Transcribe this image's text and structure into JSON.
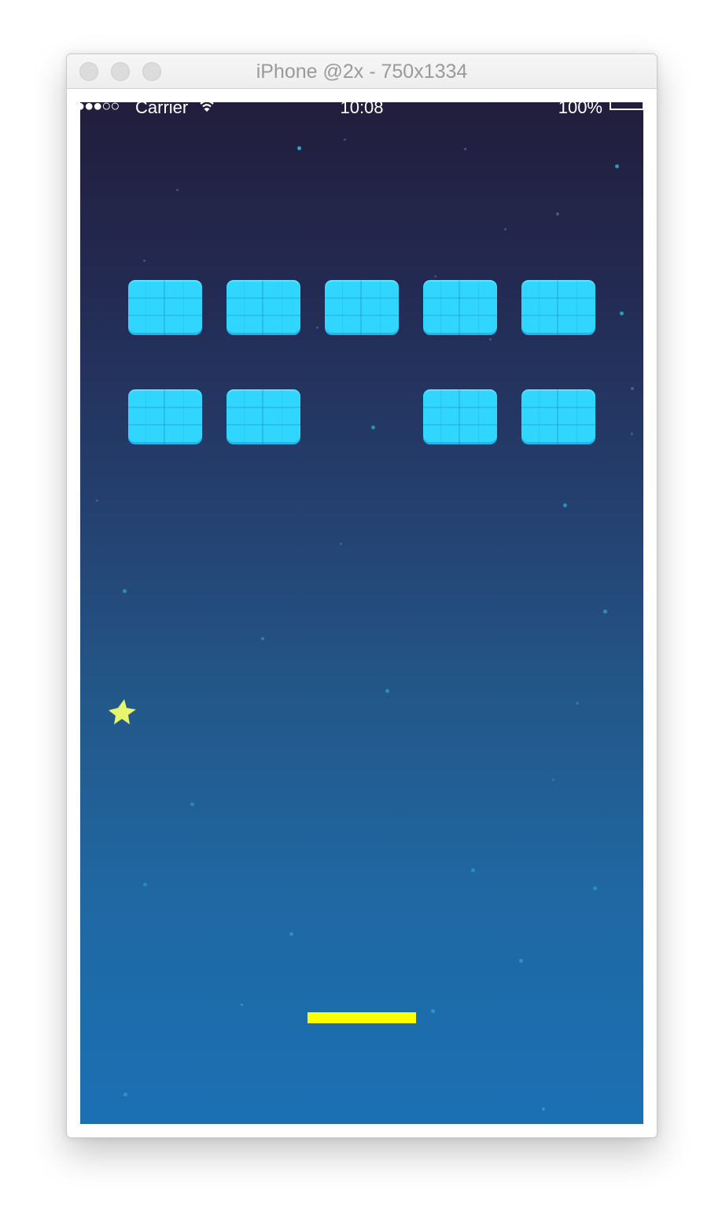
{
  "window": {
    "title": "iPhone @2x - 750x1334"
  },
  "statusbar": {
    "signal": "●●●○○",
    "carrier": "Carrier",
    "time": "10:08",
    "battery": "100%"
  },
  "game": {
    "brick_rows": [
      [
        true,
        true,
        true,
        true,
        true
      ],
      [
        true,
        true,
        false,
        true,
        true
      ]
    ],
    "colors": {
      "brick": "#31d6ff",
      "paddle": "#ffff00",
      "ball": "#e6f56a",
      "sky_top": "#221d3c",
      "sky_bottom": "#1b70b4"
    },
    "icons": {
      "ball": "star-icon",
      "wifi": "wifi-icon",
      "battery": "battery-icon"
    }
  }
}
